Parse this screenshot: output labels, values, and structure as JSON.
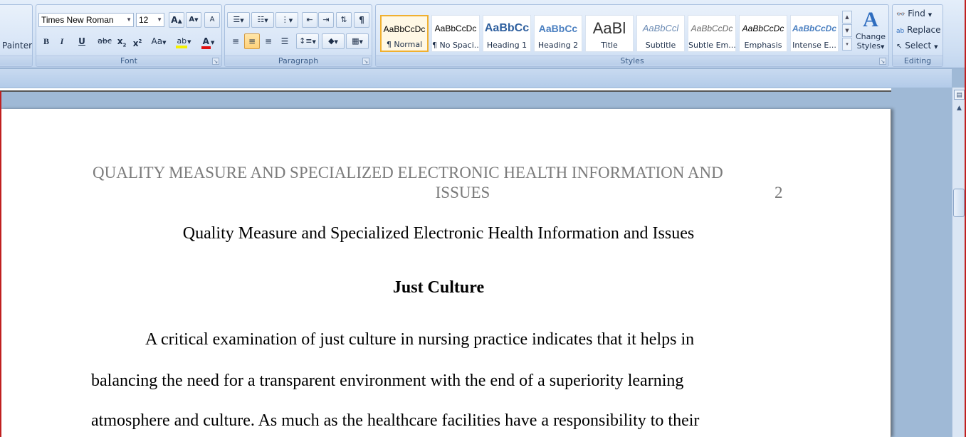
{
  "ribbon": {
    "clipboard": {
      "painter_label": "Painter"
    },
    "font": {
      "group_label": "Font",
      "font_name": "Times New Roman",
      "font_size": "12",
      "grow_label": "A",
      "shrink_label": "A",
      "clear_label": "A",
      "bold_label": "B",
      "italic_label": "I",
      "underline_label": "U",
      "strike_label": "abc",
      "subscript_label": "x",
      "superscript_label": "x",
      "case_label": "Aa",
      "highlight_label": "ab",
      "font_color_label": "A"
    },
    "paragraph": {
      "group_label": "Paragraph",
      "pilcrow_label": "¶"
    },
    "styles": {
      "group_label": "Styles",
      "items": [
        {
          "sample": "AaBbCcDc",
          "name": "¶ Normal"
        },
        {
          "sample": "AaBbCcDc",
          "name": "¶ No Spaci..."
        },
        {
          "sample": "AaBbCc",
          "name": "Heading 1"
        },
        {
          "sample": "AaBbCc",
          "name": "Heading 2"
        },
        {
          "sample": "AaBl",
          "name": "Title"
        },
        {
          "sample": "AaBbCcl",
          "name": "Subtitle"
        },
        {
          "sample": "AaBbCcDc",
          "name": "Subtle Em..."
        },
        {
          "sample": "AaBbCcDc",
          "name": "Emphasis"
        },
        {
          "sample": "AaBbCcDc",
          "name": "Intense E..."
        }
      ],
      "change_styles_label_1": "Change",
      "change_styles_label_2": "Styles"
    },
    "editing": {
      "group_label": "Editing",
      "find_label": "Find",
      "replace_label": "Replace",
      "select_label": "Select"
    }
  },
  "document": {
    "header_line1": "QUALITY MEASURE AND SPECIALIZED ELECTRONIC HEALTH INFORMATION AND",
    "header_line2": "ISSUES",
    "page_number": "2",
    "title": "Quality Measure and Specialized Electronic Health Information and Issues",
    "heading": "Just Culture",
    "body_lines": [
      "A critical examination of just culture in nursing practice indicates that it helps in",
      "balancing the need for a transparent environment with the end of a superiority learning",
      "atmosphere and culture. As much as the healthcare facilities have a responsibility to their"
    ]
  },
  "colors": {
    "ribbon_bg": "#d6e4f6",
    "workspace_bg": "#9fb9d6",
    "header_text": "#7b7b7b",
    "selected_style_border": "#f0b030"
  }
}
